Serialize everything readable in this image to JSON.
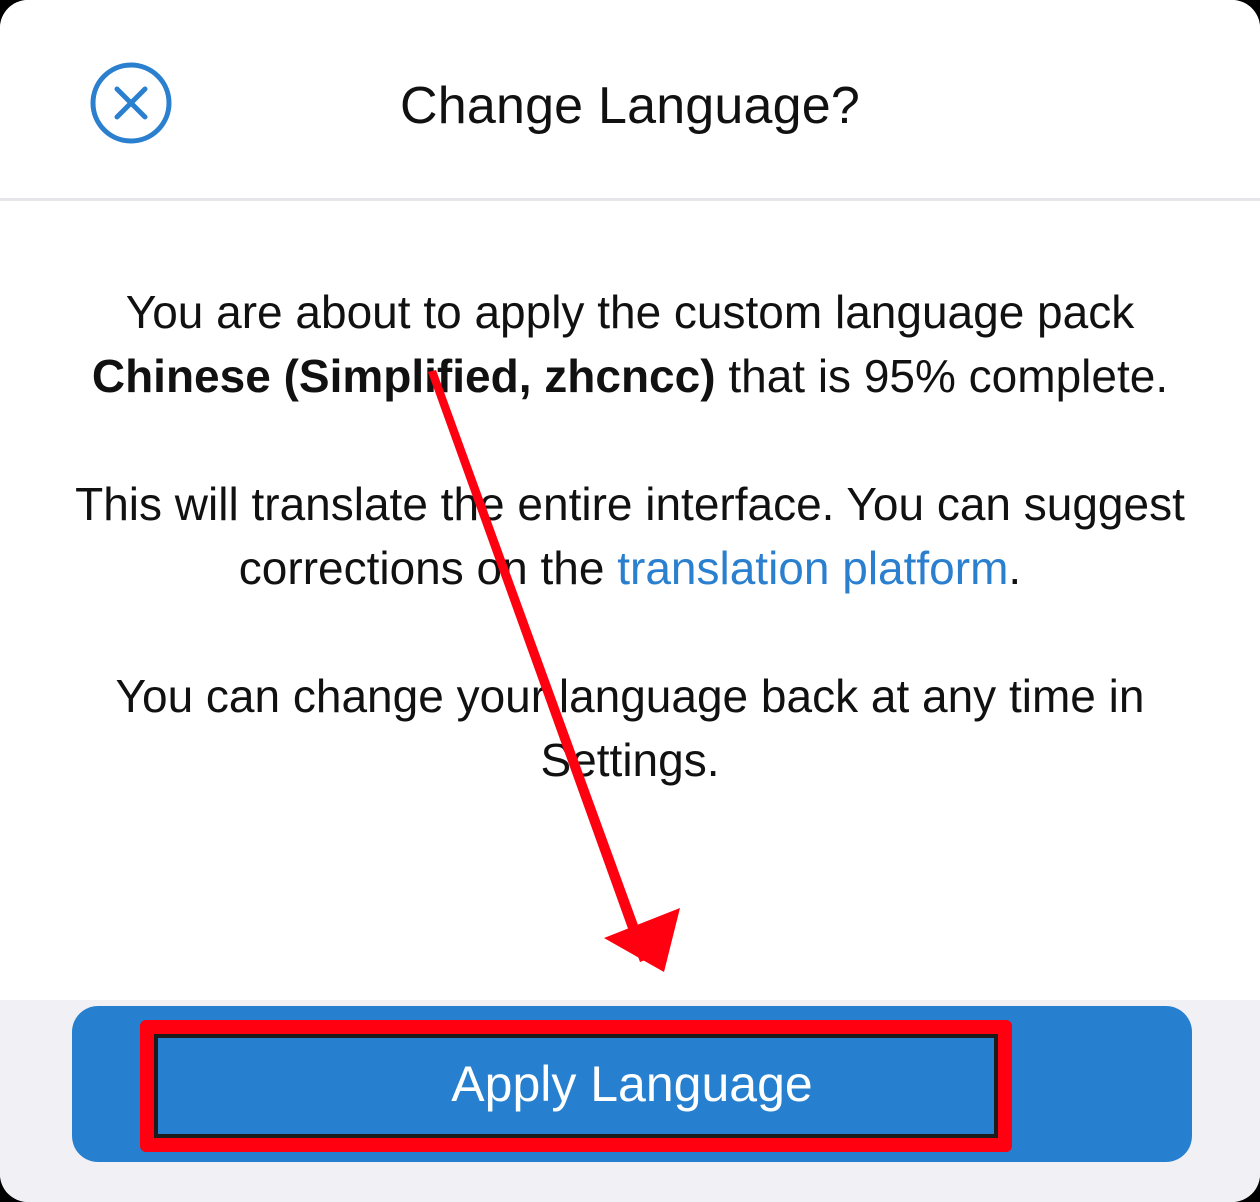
{
  "dialog": {
    "title": "Change Language?",
    "close_icon": "close-circle-icon"
  },
  "message": {
    "p1_prefix": "You are about to apply the custom language pack ",
    "p1_language": "Chinese (Simplified, zhcncc)",
    "p1_suffix": " that is 95% complete.",
    "p2_prefix": "This will translate the entire interface. You can suggest corrections on the ",
    "p2_link": "translation platform",
    "p2_suffix": ".",
    "p3": "You can change your language back at any time in Settings."
  },
  "actions": {
    "apply_label": "Apply Language"
  },
  "colors": {
    "accent": "#2680cf",
    "link": "#2a7fce",
    "annotation": "#ff0010"
  }
}
